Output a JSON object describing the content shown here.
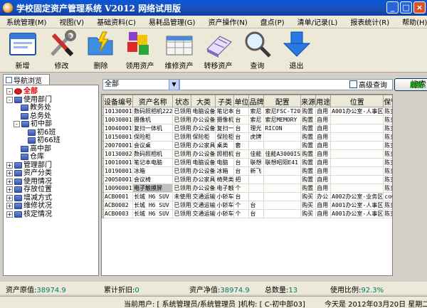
{
  "window": {
    "title": "学校固定资产管理系统 V2012 网络试用版"
  },
  "menu": [
    "系统管理(M)",
    "视图(V)",
    "基础资料(C)",
    "易耗品管理(G)",
    "资产操作(N)",
    "盘点(P)",
    "清单/记录(L)",
    "报表统计(R)",
    "帮助(H)"
  ],
  "toolbar": [
    {
      "label": "新增",
      "icon": "new-window-icon"
    },
    {
      "label": "修改",
      "icon": "tools-icon"
    },
    {
      "label": "删除",
      "icon": "delete-folder-icon"
    },
    {
      "label": "领用资产",
      "icon": "cubes-icon"
    },
    {
      "label": "维修资产",
      "icon": "repair-table-icon"
    },
    {
      "label": "转移资产",
      "icon": "notebook-icon"
    },
    {
      "label": "查询",
      "icon": "magnifier-icon"
    },
    {
      "label": "退出",
      "icon": "exit-arrow-icon"
    }
  ],
  "nav": {
    "tab": "导航浏览",
    "tree": [
      {
        "label": "全部",
        "level": 0,
        "exp": "-",
        "root": true,
        "selected": true
      },
      {
        "label": "使用部门",
        "level": 0,
        "exp": "-"
      },
      {
        "label": "教务处",
        "level": 2,
        "exp": ""
      },
      {
        "label": "总务处",
        "level": 2,
        "exp": ""
      },
      {
        "label": "初中部",
        "level": 1,
        "exp": "-"
      },
      {
        "label": "初6班",
        "level": 3,
        "exp": ""
      },
      {
        "label": "初66班",
        "level": 3,
        "exp": ""
      },
      {
        "label": "高中部",
        "level": 2,
        "exp": ""
      },
      {
        "label": "仓库",
        "level": 2,
        "exp": ""
      },
      {
        "label": "管理部门",
        "level": 0,
        "exp": "+"
      },
      {
        "label": "资产分类",
        "level": 0,
        "exp": "+"
      },
      {
        "label": "使用情况",
        "level": 0,
        "exp": "+"
      },
      {
        "label": "存放位置",
        "level": 0,
        "exp": "+"
      },
      {
        "label": "增减方式",
        "level": 0,
        "exp": "+"
      },
      {
        "label": "维修状况",
        "level": 0,
        "exp": "+"
      },
      {
        "label": "核定情况",
        "level": 0,
        "exp": "+"
      }
    ]
  },
  "filter": {
    "combo": "全部",
    "search_label": "搜索",
    "advanced_label": "高级查询",
    "refresh_label": "刷新"
  },
  "table": {
    "columns": [
      "设备编号",
      "资产名称",
      "状态",
      "大类",
      "子类",
      "单位",
      "品牌",
      "配置",
      "来源",
      "用途",
      "位置",
      "保管人"
    ],
    "widths": [
      38,
      56,
      28,
      44,
      28,
      20,
      22,
      48,
      22,
      22,
      78,
      26
    ],
    "rows": [
      [
        "10130001",
        "数码照相机222",
        "已领用",
        "电脑设备",
        "笔记本",
        "台",
        "索尼",
        "索尼FSC-T20",
        "购置",
        "自用",
        "A001办公室-人事区",
        "陈克梅"
      ],
      [
        "10030001",
        "摄像机",
        "已领用",
        "办公设备",
        "摄像机",
        "台",
        "索尼",
        "索尼MEMORY",
        "购置",
        "自用",
        "",
        "陈克梅"
      ],
      [
        "10040001",
        "复扫一体机",
        "已领用",
        "办公设备",
        "复扫一",
        "台",
        "理光",
        "RICON",
        "购置",
        "自用",
        "",
        "陈克梅"
      ],
      [
        "10150001",
        "保险柜",
        "已领用",
        "保险柜",
        "保险柜",
        "台",
        "虎牌",
        "",
        "购置",
        "自用",
        "",
        "陈克梅"
      ],
      [
        "20070001",
        "会议桌",
        "已领用",
        "办公家具",
        "桌类",
        "套",
        "",
        "",
        "购置",
        "自用",
        "",
        "陈克梅"
      ],
      [
        "10130002",
        "数码照相机",
        "已领用",
        "办公设备",
        "照相机",
        "台",
        "佳能",
        "佳能A3000IS",
        "购置",
        "自用",
        "",
        "陈克梅"
      ],
      [
        "10010001",
        "笔记本电脑",
        "已领用",
        "电脑设备",
        "电脑",
        "台",
        "联想",
        "联想昭阳E41",
        "购置",
        "自用",
        "",
        "陈克梅"
      ],
      [
        "10190001",
        "冰箱",
        "已领用",
        "办公设备",
        "冰箱",
        "台",
        "新飞",
        "",
        "购置",
        "自用",
        "",
        "陈克梅"
      ],
      [
        "20050001",
        "会议椅",
        "已领用",
        "办公家具",
        "椅凳类",
        "把",
        "",
        "",
        "购置",
        "自用",
        "",
        "陈克梅"
      ],
      [
        "10090001",
        "电子触摸屏",
        "已领用",
        "办公设备",
        "电子触",
        "个",
        "",
        "",
        "购置",
        "自用",
        "",
        "陈克梅"
      ],
      [
        "ACB0001",
        "长城 H6 SUV",
        "未使用",
        "交通运输",
        "小轿车",
        "台",
        "",
        "",
        "购买",
        "办公",
        "A002办公室-业务区",
        "cowbo"
      ],
      [
        "ACB0002",
        "长城 H6 SUV",
        "已领用",
        "交通运输",
        "小轿车",
        "个",
        "台",
        "",
        "购买",
        "自用",
        "A001办公室-人事区",
        "陈克梅"
      ],
      [
        "ACB0003",
        "长城 H6 SUV",
        "已领用",
        "交通运输",
        "小轿车",
        "个",
        "台",
        "",
        "购买",
        "自用",
        "A001办公室-人事区",
        "陈克梅"
      ]
    ]
  },
  "stats": {
    "original_label": "资产原值:",
    "original_value": "38974.9",
    "depr_label": "累计折旧:",
    "depr_value": "0",
    "net_label": "资产净值:",
    "net_value": "38974.9",
    "count_label": "总数量:",
    "count_value": "13",
    "ratio_label": "使用比例:",
    "ratio_value": "92.3%"
  },
  "status": {
    "user": "当前用户: [ 系统管理员/系统管理员 ]机构: [ C-初中部03]",
    "today": "今天是  2012年03月20日  星期二"
  },
  "colors": {
    "accent": "#0a56d6",
    "value": "#007a6a",
    "refresh": "#009000"
  }
}
